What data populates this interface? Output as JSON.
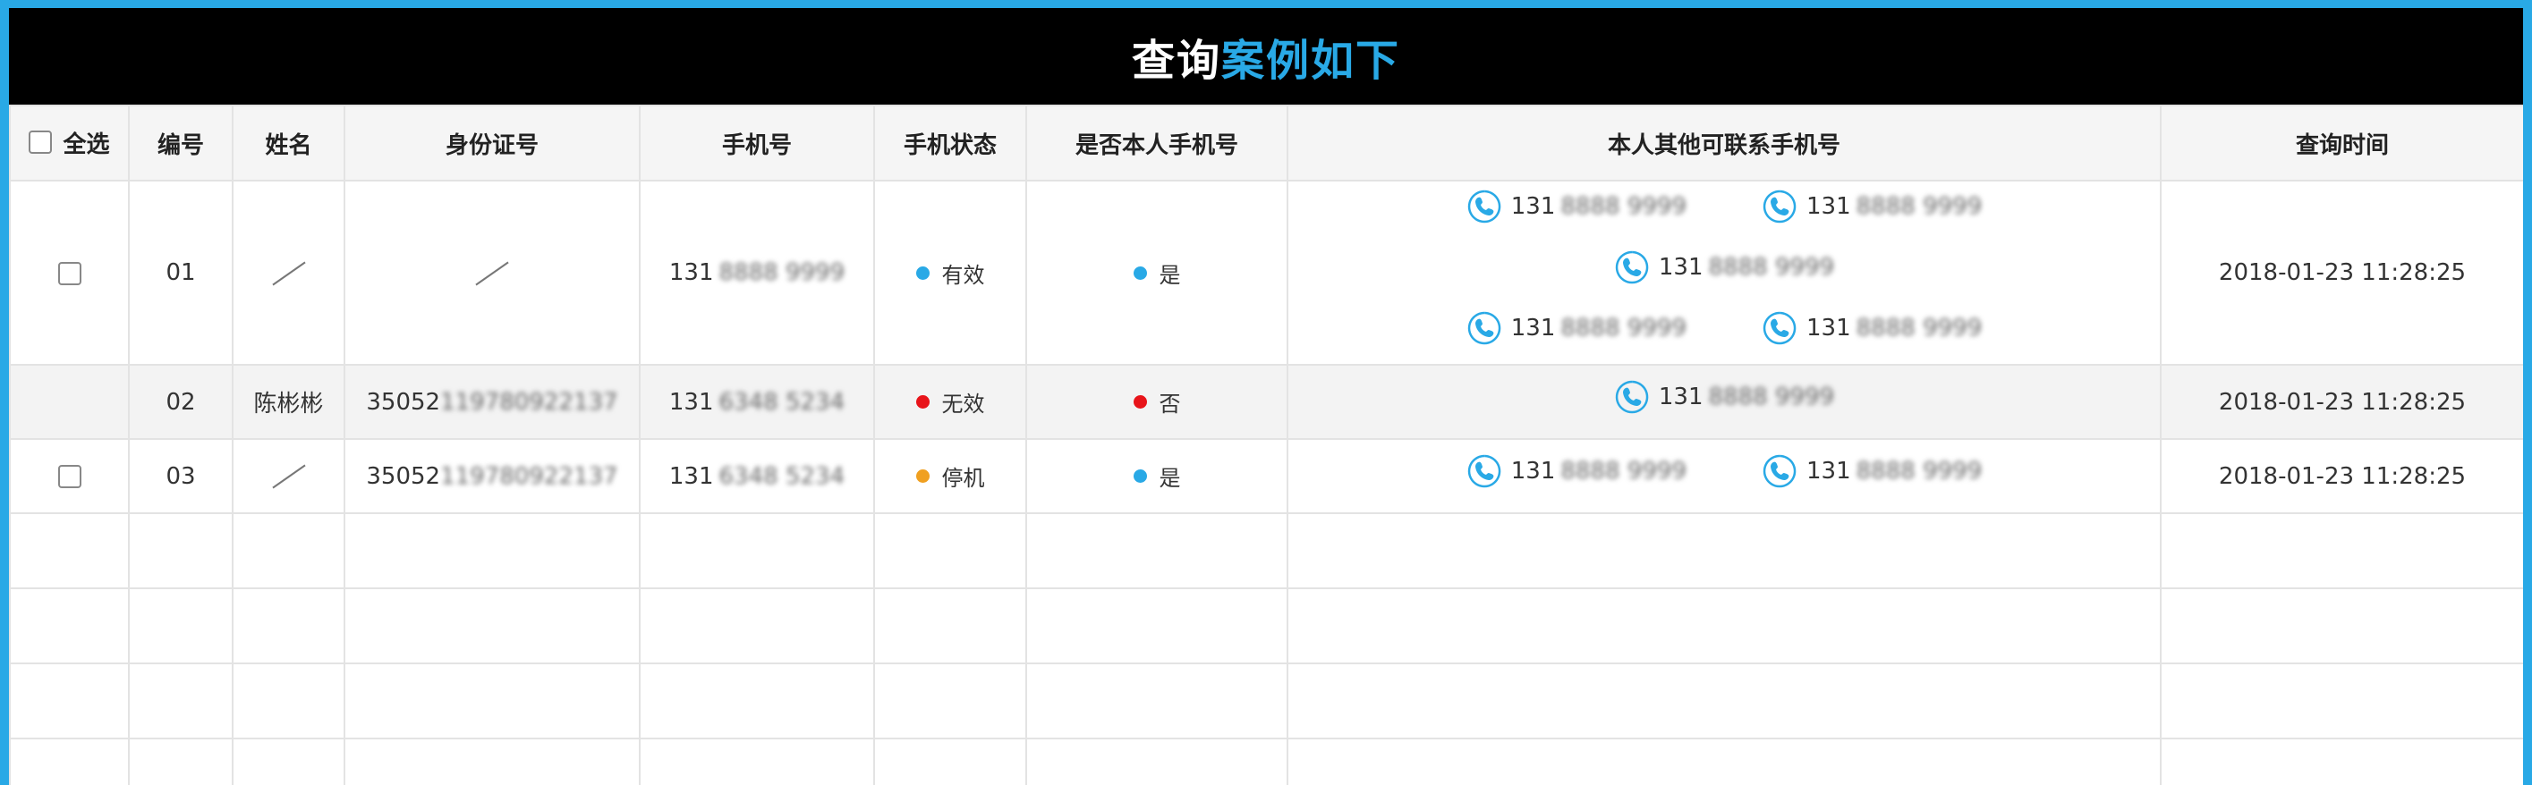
{
  "title": {
    "part1": "查询",
    "part2": "案例如下"
  },
  "headers": {
    "select_all": "全选",
    "number": "编号",
    "name": "姓名",
    "id_card": "身份证号",
    "phone": "手机号",
    "phone_status": "手机状态",
    "is_own": "是否本人手机号",
    "other_phones": "本人其他可联系手机号",
    "query_time": "查询时间"
  },
  "rows": [
    {
      "number": "01",
      "name": "",
      "id_prefix": "",
      "id_masked": "",
      "phone_prefix": "131",
      "phone_masked": "8888 9999",
      "status": "有效",
      "status_color": "#29a9e6",
      "is_own": "是",
      "is_own_color": "#29a9e6",
      "other_phones": [
        {
          "prefix": "131",
          "masked": "8888 9999"
        },
        {
          "prefix": "131",
          "masked": "8888 9999"
        },
        {
          "prefix": "131",
          "masked": "8888 9999"
        },
        {
          "prefix": "131",
          "masked": "8888 9999"
        },
        {
          "prefix": "131",
          "masked": "8888 9999"
        }
      ],
      "time": "2018-01-23 11:28:25"
    },
    {
      "number": "02",
      "name": "陈彬彬",
      "id_prefix": "35052",
      "id_masked": "119780922137",
      "phone_prefix": "131",
      "phone_masked": "6348 5234",
      "status": "无效",
      "status_color": "#e8141a",
      "is_own": "否",
      "is_own_color": "#e8141a",
      "other_phones": [
        {
          "prefix": "131",
          "masked": "8888 9999"
        }
      ],
      "time": "2018-01-23 11:28:25"
    },
    {
      "number": "03",
      "name": "",
      "id_prefix": "35052",
      "id_masked": "119780922137",
      "phone_prefix": "131",
      "phone_masked": "6348 5234",
      "status": "停机",
      "status_color": "#f0a020",
      "is_own": "是",
      "is_own_color": "#29a9e6",
      "other_phones": [
        {
          "prefix": "131",
          "masked": "8888 9999"
        },
        {
          "prefix": "131",
          "masked": "8888 9999"
        }
      ],
      "time": "2018-01-23 11:28:25"
    }
  ],
  "colors": {
    "accent": "#29a9e6",
    "title_bg": "#000000"
  },
  "icons": {
    "phone": "phone-icon",
    "checkbox": "checkbox",
    "slash": "slash-placeholder-icon"
  }
}
